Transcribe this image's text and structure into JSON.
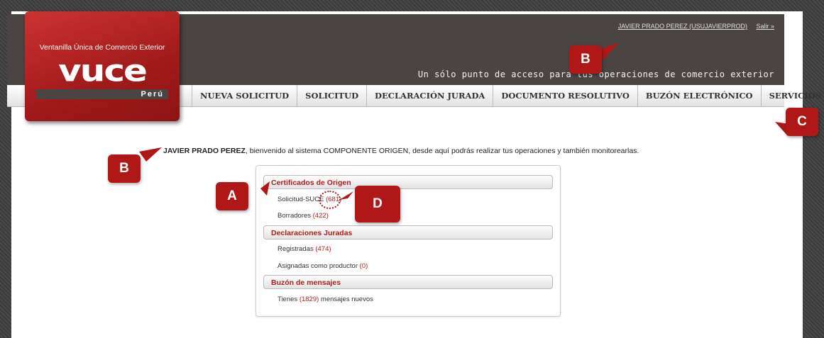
{
  "header": {
    "user_link": "JAVIER PRADO PEREZ (USUJAVIERPROD)",
    "logout_link": "Salir »",
    "tagline": "Un sólo punto de acceso para tus operaciones de comercio exterior"
  },
  "logo": {
    "title": "Ventanilla Única de Comercio Exterior",
    "word": "vuce",
    "country": "Perú"
  },
  "nav": [
    {
      "label": "NUEVA SOLICITUD"
    },
    {
      "label": "SOLICITUD"
    },
    {
      "label": "DECLARACIÓN JURADA"
    },
    {
      "label": "DOCUMENTO RESOLUTIVO"
    },
    {
      "label": "BUZÓN ELECTRÓNICO"
    },
    {
      "label": "SERVICIOS"
    }
  ],
  "welcome": {
    "name": "JAVIER PRADO PEREZ",
    "text": ", bienvenido al sistema COMPONENTE ORIGEN, desde aquí podrás realizar tus operaciones y también monitorearlas."
  },
  "panel": {
    "sections": [
      {
        "title": "Certificados de Origen"
      },
      {
        "title": "Declaraciones Juradas"
      },
      {
        "title": "Buzón de mensajes"
      }
    ],
    "items": {
      "solicitud_suce": {
        "label": "Solicitud-SUCE",
        "count": "(681)"
      },
      "borradores": {
        "label": "Borradores",
        "count": "(422)"
      },
      "registradas": {
        "label": "Registradas",
        "count": "(474)"
      },
      "asignadas": {
        "label": "Asignadas como productor",
        "count": "(0)"
      },
      "mensajes": {
        "prefix": "Tienes",
        "count": "(1829)",
        "suffix": "mensajes nuevos"
      }
    }
  },
  "callouts": {
    "a": "A",
    "b_top": "B",
    "b_left": "B",
    "c": "C",
    "d": "D"
  },
  "colors": {
    "brand_red": "#b01818",
    "header_dark": "#4a4542"
  }
}
